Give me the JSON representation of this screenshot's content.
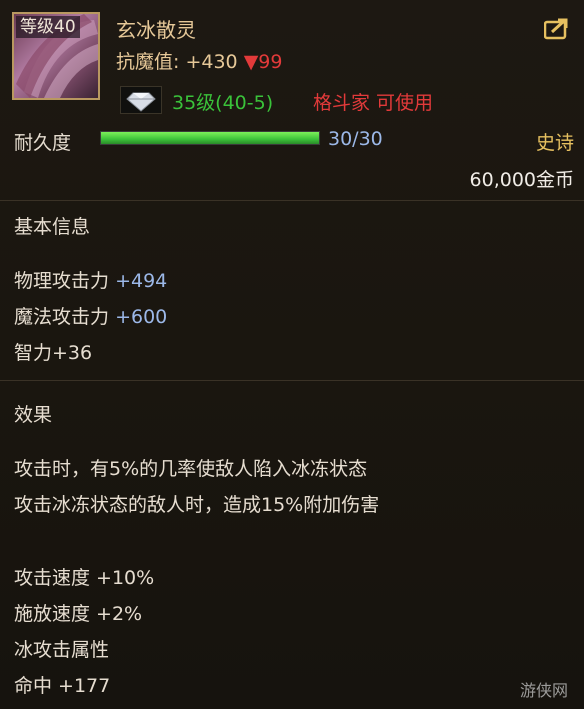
{
  "item": {
    "level_badge": "等级40",
    "name": "玄冰散灵",
    "resist_label": "抗魔值:",
    "resist_bonus": "+430",
    "resist_penalty": "▼99",
    "req_level": "35级(40-5)",
    "req_class": "格斗家 可使用",
    "durability_label": "耐久度",
    "durability_value": "30/30",
    "durability_fraction": 1.0,
    "rarity": "史诗",
    "price": "60,000金币"
  },
  "basic": {
    "title": "基本信息",
    "stats": [
      {
        "label": "物理攻击力",
        "value": "+494"
      },
      {
        "label": "魔法攻击力",
        "value": "+600"
      },
      {
        "label": "智力+36",
        "value": ""
      }
    ]
  },
  "effect": {
    "title": "效果",
    "lines": [
      "攻击时，有5%的几率使敌人陷入冰冻状态",
      "攻击冰冻状态的敌人时，造成15%附加伤害",
      "攻击速度 +10%",
      "施放速度 +2%",
      "冰攻击属性",
      "命中 +177"
    ]
  },
  "watermark": "游侠网",
  "colors": {
    "name": "#e6c898",
    "penalty": "#e23a3a",
    "req_level": "#3ac23a",
    "req_class": "#e23a3a",
    "rarity": "#e6c060",
    "stat_value": "#9cb8e8"
  },
  "icons": [
    "item-icon",
    "diamond-icon",
    "share-icon"
  ]
}
